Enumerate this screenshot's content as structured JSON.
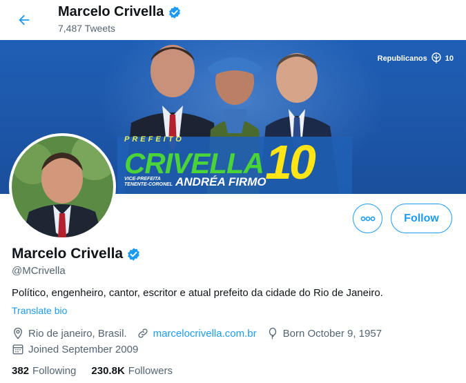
{
  "header": {
    "name": "Marcelo Crivella",
    "tweet_count": "7,487 Tweets"
  },
  "banner": {
    "party_label": "Republicanos",
    "party_number": "10",
    "promo_top": "PREFEITO",
    "promo_name": "CRIVELLA",
    "promo_number": "10",
    "promo_vice_small_1": "VICE-PREFEITA",
    "promo_vice_small_2": "TENENTE-CORONEL",
    "promo_vice_name": "ANDRÉA FIRMO"
  },
  "actions": {
    "more_icon": "more-horizontal-icon",
    "follow_label": "Follow"
  },
  "profile": {
    "name": "Marcelo Crivella",
    "handle": "@MCrivella",
    "bio": "Político, engenheiro, cantor, escritor e atual prefeito da cidade do Rio de Janeiro.",
    "translate_label": "Translate bio",
    "location": "Rio de janeiro, Brasil.",
    "website": "marcelocrivella.com.br",
    "birth": "Born October 9, 1957",
    "joined": "Joined September 2009"
  },
  "stats": {
    "following_count": "382",
    "following_label": "Following",
    "followers_count": "230.8K",
    "followers_label": "Followers"
  },
  "colors": {
    "accent": "#1d9bf0",
    "verified": "#1d9bf0",
    "banner": "#1f5fb5",
    "promo_green": "#4bd33a",
    "promo_yellow": "#ffe516"
  }
}
